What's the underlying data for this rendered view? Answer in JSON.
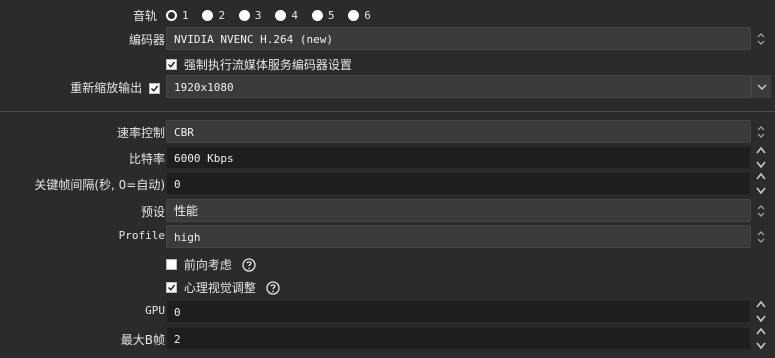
{
  "audio_track": {
    "label": "音轨",
    "options": [
      "1",
      "2",
      "3",
      "4",
      "5",
      "6"
    ],
    "selected": "1"
  },
  "encoder": {
    "label": "编码器",
    "value": "NVIDIA NVENC H.264 (new)"
  },
  "enforce_stream": {
    "label": "强制执行流媒体服务编码器设置",
    "checked": true
  },
  "rescale": {
    "label": "重新缩放输出",
    "checked": true,
    "value": "1920x1080"
  },
  "rate_control": {
    "label": "速率控制",
    "value": "CBR"
  },
  "bitrate": {
    "label": "比特率",
    "value": "6000 Kbps"
  },
  "keyframe": {
    "label": "关键帧间隔(秒, 0=自动)",
    "value": "0"
  },
  "preset": {
    "label": "预设",
    "value": "性能"
  },
  "profile": {
    "label": "Profile",
    "value": "high"
  },
  "lookahead": {
    "label": "前向考虑",
    "checked": false
  },
  "psycho": {
    "label": "心理视觉调整",
    "checked": true
  },
  "gpu": {
    "label": "GPU",
    "value": "0"
  },
  "max_bframes": {
    "label": "最大B帧",
    "value": "2"
  },
  "colors": {
    "bg": "#2b2b2b",
    "combo": "#3b3b3b",
    "spin": "#1e1e1e"
  }
}
